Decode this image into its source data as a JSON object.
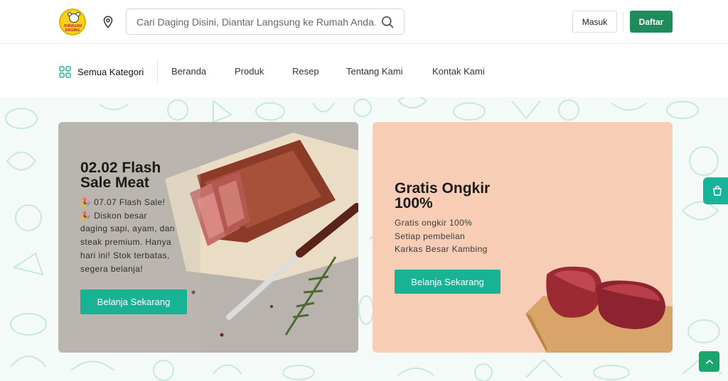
{
  "header": {
    "logo_text": "JURAGAN DAGING",
    "logo_icon": "cow-logo-icon",
    "location_icon": "map-pin-icon",
    "search": {
      "placeholder": "Cari Daging Disini, Diantar Langsung ke Rumah Anda....",
      "value": "",
      "icon": "search-icon"
    },
    "login_label": "Masuk",
    "register_label": "Daftar"
  },
  "nav": {
    "categories_label": "Semua Kategori",
    "categories_icon": "grid-icon",
    "links": [
      {
        "label": "Beranda"
      },
      {
        "label": "Produk"
      },
      {
        "label": "Resep"
      },
      {
        "label": "Tentang Kami"
      },
      {
        "label": "Kontak Kami"
      }
    ]
  },
  "banners": [
    {
      "title": "02.02 Flash Sale Meat",
      "title_line1": "02.02 Flash",
      "title_line2": "Sale Meat",
      "description_lines": [
        "🎉 07.07 Flash Sale!",
        "🎉 Diskon besar",
        "daging sapi, ayam, dan",
        "steak premium. Hanya",
        "hari ini! Stok terbatas,",
        "segera belanja!"
      ],
      "button_label": "Belanja Sekarang"
    },
    {
      "title_line1": "Gratis Ongkir",
      "title_line2": "100%",
      "description_lines": [
        "Gratis ongkir 100%",
        "Setiap pembelian",
        "Karkas Besar Kambing"
      ],
      "button_label": "Belanja Sekarang"
    }
  ],
  "floating": {
    "cart_icon": "shopping-bag-icon",
    "back_to_top_icon": "chevron-up-icon"
  },
  "colors": {
    "primary_green": "#1d8b5a",
    "accent_teal": "#17b394",
    "banner2_bg": "#f7ceb5",
    "pattern": "#c7e8df"
  }
}
